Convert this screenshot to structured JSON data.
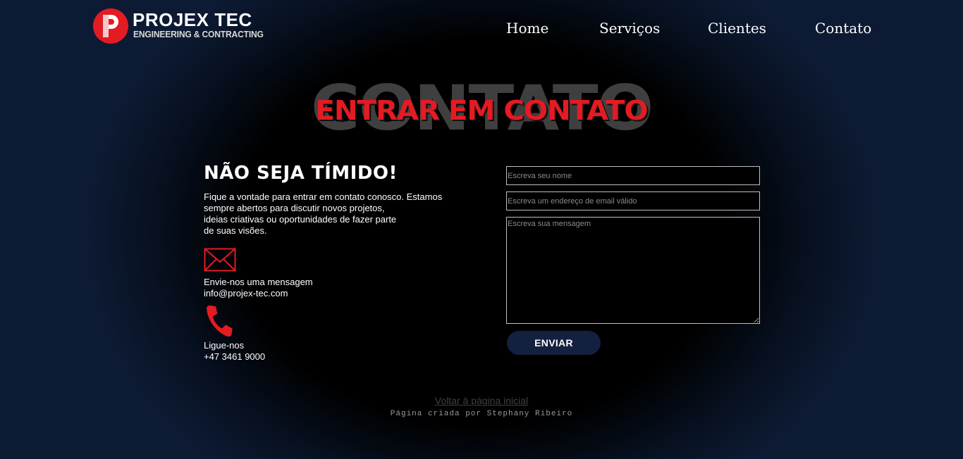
{
  "header": {
    "logo": {
      "title": "PROJEX TEC",
      "subtitle": "ENGINEERING & CONTRACTING"
    },
    "nav": [
      {
        "label": "Home"
      },
      {
        "label": "Serviços"
      },
      {
        "label": "Clientes"
      },
      {
        "label": "Contato"
      }
    ]
  },
  "hero": {
    "background_word": "CONTATO",
    "title": "ENTRAR EM CONTATO"
  },
  "contact_info": {
    "heading": "NÃO SEJA TÍMIDO!",
    "intro_lines": [
      "Fique a vontade para entrar em contato conosco. Estamos",
      "sempre abertos para discutir novos projetos,",
      "ideias criativas ou oportunidades de fazer parte",
      "de suas visões."
    ],
    "email": {
      "icon": "mail-icon",
      "label": "Envie-nos uma mensagem",
      "value": "info@projex-tec.com"
    },
    "phone": {
      "icon": "phone-icon",
      "label": "Ligue-nos",
      "value": "+47 3461 9000"
    }
  },
  "form": {
    "name_placeholder": "Escreva seu nome",
    "email_placeholder": "Escreva um endereço de email válido",
    "message_placeholder": "Escreva sua mensagem",
    "name_value": "",
    "email_value": "",
    "message_value": "",
    "submit_label": "ENVIAR"
  },
  "footer": {
    "back_link": "Voltar à página inicial",
    "credit": "Página criada por Stephany Ribeiro"
  },
  "colors": {
    "accent": "#e31b23",
    "button_bg": "#14203f",
    "page_edge": "#0d1a33"
  }
}
